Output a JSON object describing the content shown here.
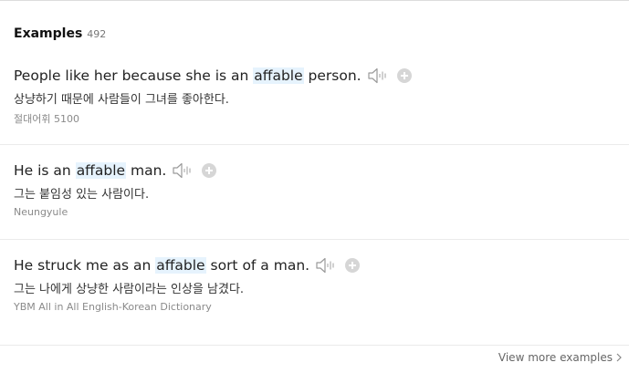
{
  "header": {
    "title": "Examples",
    "count": "492"
  },
  "examples": [
    {
      "en_before": "People like her because she is an ",
      "keyword": "affable",
      "en_after": " person.",
      "ko": "상냥하기 때문에 사람들이 그녀를 좋아한다.",
      "source": "절대어휘 5100"
    },
    {
      "en_before": "He is an ",
      "keyword": "affable",
      "en_after": " man.",
      "ko": "그는 붙임성 있는 사람이다.",
      "source": "Neungyule"
    },
    {
      "en_before": "He struck me as an ",
      "keyword": "affable",
      "en_after": " sort of a man.",
      "ko": "그는 나에게 상냥한 사람이라는 인상을 남겼다.",
      "source": "YBM All in All English-Korean Dictionary"
    }
  ],
  "footer": {
    "more_label": "View more examples"
  },
  "colors": {
    "highlight": "#e6f3fd",
    "divider": "#ebebeb",
    "icon": "#9a9a9a"
  },
  "icons": {
    "speaker": "speaker-icon",
    "add": "plus-circle-icon",
    "more": "chevron-right-icon"
  }
}
